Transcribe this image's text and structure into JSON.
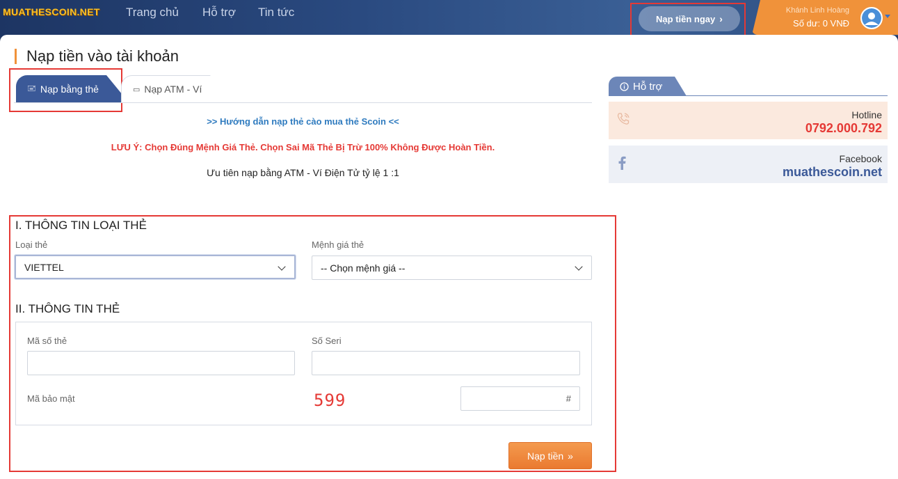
{
  "header": {
    "logo": "MUATHESCOIN.NET",
    "nav": [
      "Trang chủ",
      "Hỗ trợ",
      "Tin tức"
    ],
    "cta_label": "Nạp tiền ngay",
    "user_name": "Khánh Linh Hoàng",
    "balance": "Số dư: 0 VNĐ"
  },
  "page": {
    "title": "Nạp tiền vào tài khoản",
    "tabs": [
      {
        "label": "Nạp bằng thẻ",
        "icon": "card-icon",
        "active": true
      },
      {
        "label": "Nạp ATM - Ví",
        "icon": "atm-icon",
        "active": false
      }
    ],
    "guide_link": ">> Hướng dẫn nạp thẻ cào mua thẻ Scoin <<",
    "warning": "LƯU Ý: Chọn Đúng Mệnh Giá Thẻ. Chọn Sai Mã Thẻ Bị Trừ 100% Không Được Hoàn Tiền.",
    "priority": "Ưu tiên nạp bằng ATM - Ví Điện Tử tỷ lệ 1 :1"
  },
  "form": {
    "section1_title": "I. THÔNG TIN LOẠI THẺ",
    "card_type_label": "Loại thẻ",
    "card_type_value": "VIETTEL",
    "denomination_label": "Mệnh giá thẻ",
    "denomination_value": "-- Chọn mệnh giá --",
    "section2_title": "II. THÔNG TIN THẺ",
    "card_code_label": "Mã số thẻ",
    "card_code_value": "",
    "serial_label": "Số Seri",
    "serial_value": "",
    "security_label": "Mã bảo mật",
    "captcha": "599",
    "captcha_placeholder": "#",
    "submit_label": "Nạp tiền"
  },
  "sidebar": {
    "tab_label": "Hỗ trợ",
    "hotline_label": "Hotline",
    "hotline_value": "0792.000.792",
    "facebook_label": "Facebook",
    "facebook_value": "muathescoin.net"
  },
  "colors": {
    "brand_blue": "#3b5998",
    "accent_orange": "#f0923a",
    "warning_red": "#e53935",
    "link_blue": "#2f7bbf"
  }
}
